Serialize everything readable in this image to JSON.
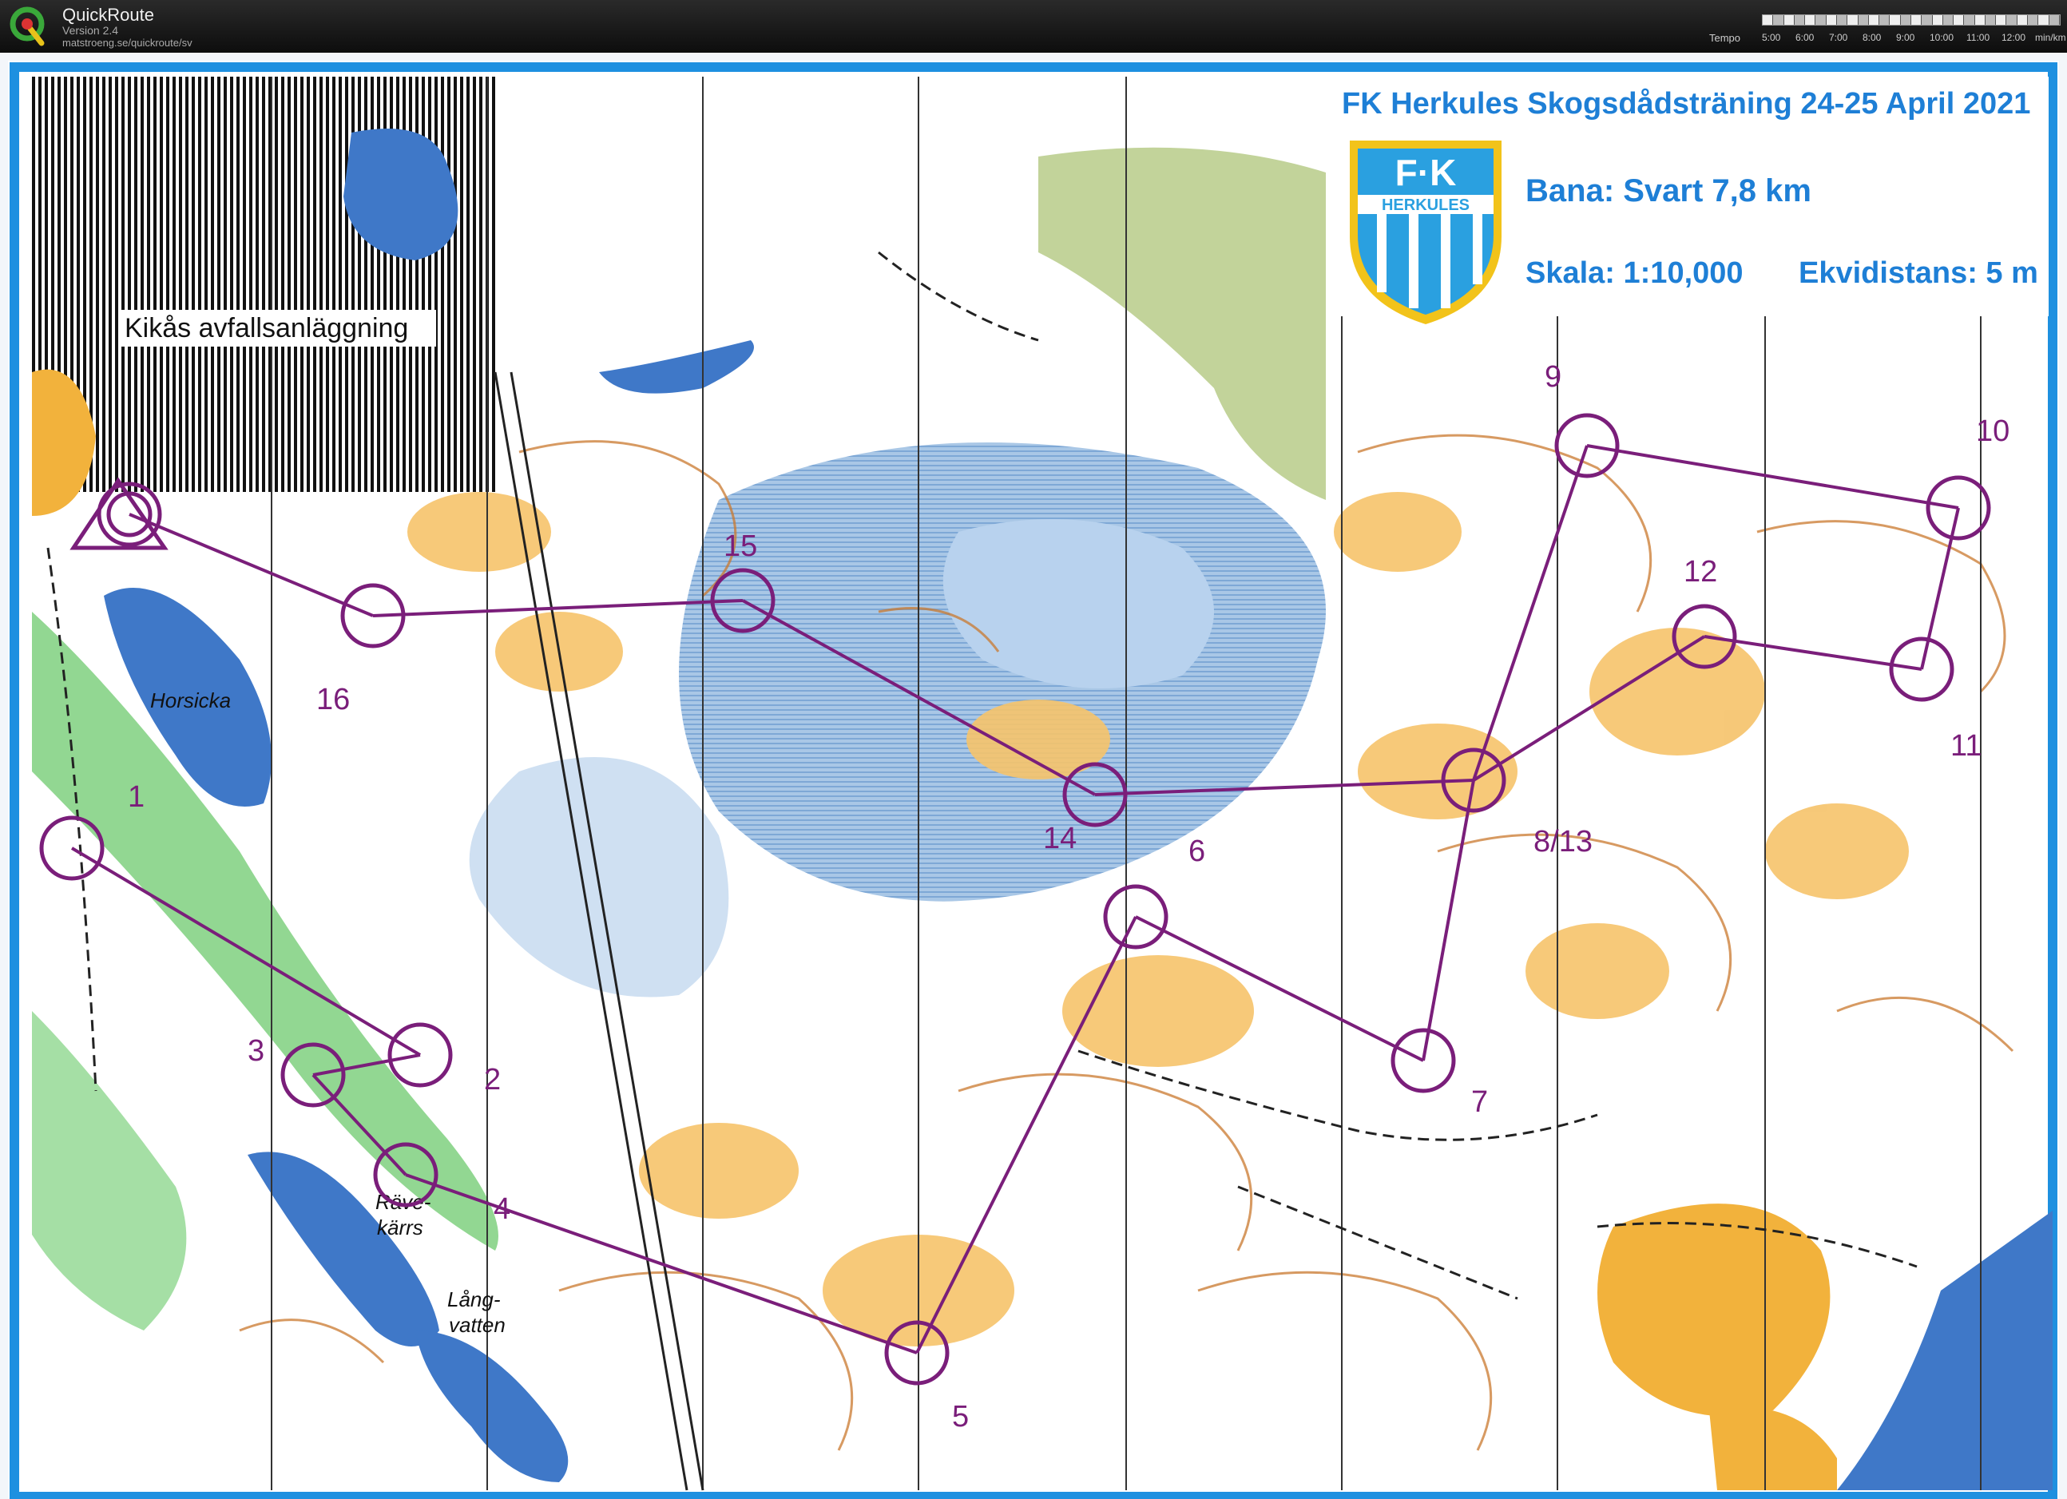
{
  "app": {
    "name": "QuickRoute",
    "version": "Version 2.4",
    "url": "matstroeng.se/quickroute/sv",
    "logo_letter": "Q",
    "logo_color": "#3aa83a"
  },
  "tempo": {
    "label": "Tempo",
    "unit": "min/km",
    "ticks": [
      "5:00",
      "6:00",
      "7:00",
      "8:00",
      "9:00",
      "10:00",
      "11:00",
      "12:00"
    ]
  },
  "map": {
    "title": "FK Herkules Skogsdådsträning 24-25 April 2021",
    "course": "Bana: Svart 7,8 km",
    "scale": "Skala: 1:10,000",
    "contour": "Ekvidistans: 5 m",
    "club_logo_text": "F·K",
    "club_logo_banner": "HERKULES",
    "place_labels": {
      "facility": "Kikås avfallsanläggning",
      "lake1": "Horsicka",
      "lake2a": "Räve-",
      "lake2b": "kärrs",
      "lake3a": "Lång-",
      "lake3b": "vatten"
    },
    "colors": {
      "course": "#7a1e7a",
      "water": "#3f78c8",
      "marsh": "#9ec3ea",
      "open": "#f2b23c",
      "forest": "#ffffff",
      "green": "#5fbf5f",
      "contour": "#c9782d",
      "border": "#1e90e0"
    },
    "controls": [
      {
        "label": "1"
      },
      {
        "label": "2"
      },
      {
        "label": "3"
      },
      {
        "label": "4"
      },
      {
        "label": "5"
      },
      {
        "label": "6"
      },
      {
        "label": "7"
      },
      {
        "label": "8/13"
      },
      {
        "label": "9"
      },
      {
        "label": "10"
      },
      {
        "label": "11"
      },
      {
        "label": "12"
      },
      {
        "label": "14"
      },
      {
        "label": "15"
      },
      {
        "label": "16"
      }
    ]
  }
}
